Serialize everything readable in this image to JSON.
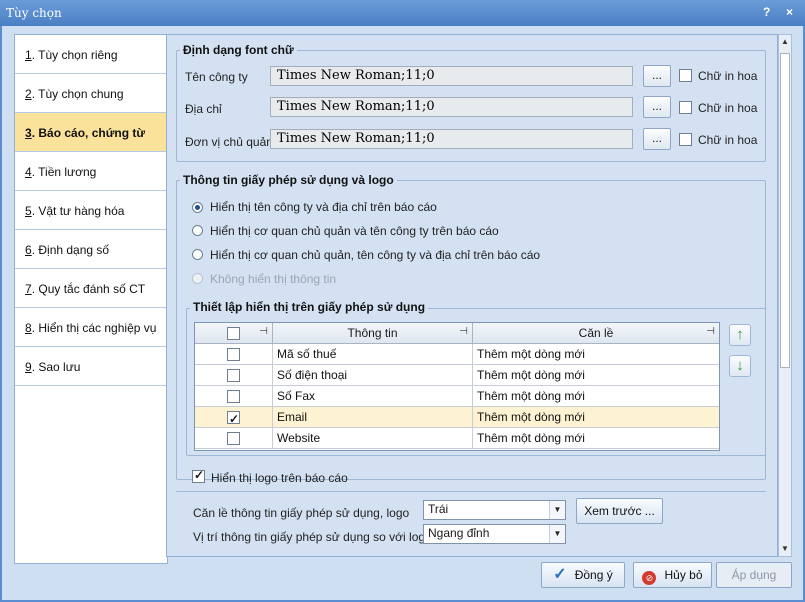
{
  "window": {
    "title": "Tùy chọn",
    "help": "?",
    "close": "×"
  },
  "nav": [
    {
      "num": "1",
      "label": ". Tùy chọn riêng"
    },
    {
      "num": "2",
      "label": ". Tùy chọn chung"
    },
    {
      "num": "3",
      "label": ". Báo cáo, chứng từ"
    },
    {
      "num": "4",
      "label": ". Tiền lương"
    },
    {
      "num": "5",
      "label": ". Vật tư hàng hóa"
    },
    {
      "num": "6",
      "label": ". Định dạng số"
    },
    {
      "num": "7",
      "label": ". Quy tắc đánh số CT"
    },
    {
      "num": "8",
      "label": ". Hiển thị các nghiệp vụ"
    },
    {
      "num": "9",
      "label": ". Sao lưu"
    }
  ],
  "font_section": {
    "title": "Định dạng font chữ",
    "rows": [
      {
        "label": "Tên công ty",
        "value": "Times New Roman;11;0",
        "btn": "...",
        "upper": "Chữ in hoa"
      },
      {
        "label": "Địa chỉ",
        "value": "Times New Roman;11;0",
        "btn": "...",
        "upper": "Chữ in hoa"
      },
      {
        "label": "Đơn vị chủ quản",
        "value": "Times New Roman;11;0",
        "btn": "...",
        "upper": "Chữ in hoa"
      }
    ]
  },
  "license_section": {
    "title": "Thông tin giấy phép sử dụng và logo",
    "options": [
      "Hiển thị tên công ty và địa chỉ trên báo cáo",
      "Hiển thị cơ quan chủ quản và tên công ty trên báo cáo",
      "Hiển thị cơ quan chủ quản, tên công ty và địa chỉ trên báo cáo",
      "Không hiển thị thông tin"
    ]
  },
  "display_section": {
    "title": "Thiết lập hiển thị trên giấy phép sử dụng",
    "col_info": "Thông tin",
    "col_align": "Căn lề",
    "rows": [
      {
        "info": "Mã số thuế",
        "align": "Thêm một dòng mới"
      },
      {
        "info": "Số điện thoại",
        "align": "Thêm một dòng mới"
      },
      {
        "info": "Số Fax",
        "align": "Thêm một dòng mới"
      },
      {
        "info": "Email",
        "align": "Thêm một dòng mới"
      },
      {
        "info": "Website",
        "align": "Thêm một dòng mới"
      }
    ],
    "move_up": "↑",
    "move_down": "↓"
  },
  "logo": {
    "show_label": "Hiển thị logo trên báo cáo",
    "align_label": "Căn lề thông tin giấy phép sử dụng, logo",
    "align_value": "Trái",
    "preview_btn": "Xem trước ...",
    "pos_label": "Vị trí thông tin giấy phép sử dụng so với logo",
    "pos_value": "Ngang đỉnh"
  },
  "buttons": {
    "ok": "Đồng ý",
    "cancel": "Hủy bỏ",
    "apply": "Áp dụng"
  }
}
